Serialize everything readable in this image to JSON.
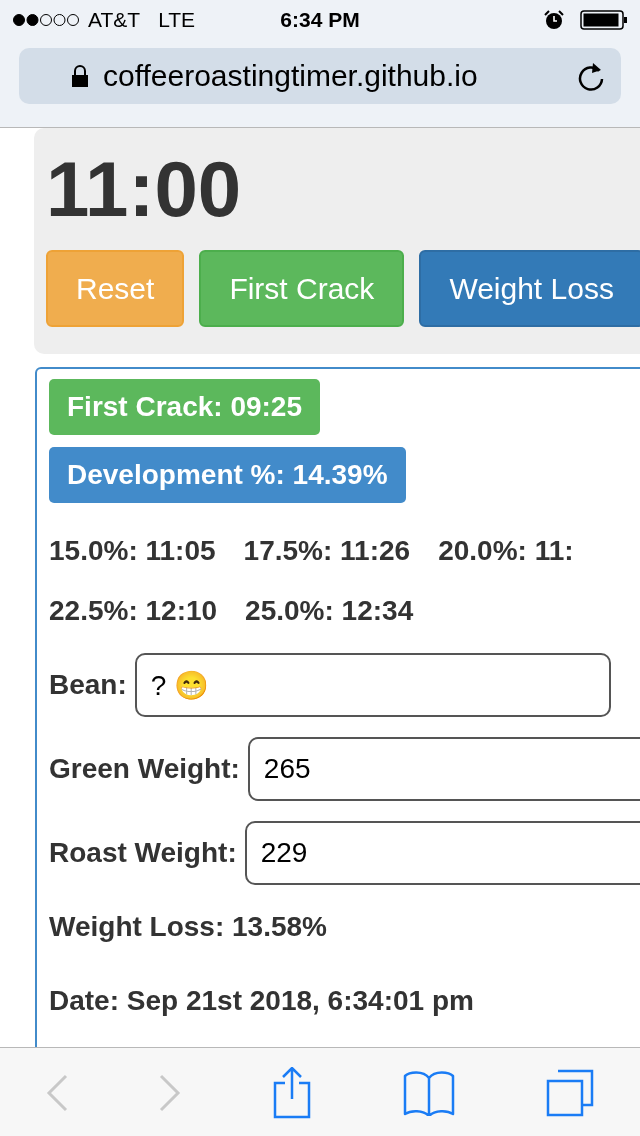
{
  "status_bar": {
    "carrier": "AT&T",
    "network": "LTE",
    "time": "6:34 PM"
  },
  "address_bar": {
    "url": "coffeeroastingtimer.github.io"
  },
  "timer": {
    "display": "11:00",
    "buttons": [
      {
        "label": "Reset",
        "kind": "warning"
      },
      {
        "label": "First Crack",
        "kind": "success"
      },
      {
        "label": "Weight Loss",
        "kind": "primary"
      }
    ]
  },
  "results": {
    "badges": [
      {
        "text": "First Crack: 09:25",
        "kind": "success"
      },
      {
        "text": "Development %: 14.39%",
        "kind": "info"
      }
    ],
    "target_rows": [
      [
        "15.0%: 11:05",
        "17.5%: 11:26",
        "20.0%: 11:"
      ],
      [
        "22.5%: 12:10",
        "25.0%: 12:34"
      ]
    ],
    "fields": [
      {
        "label": "Bean:",
        "value": "? 😁"
      },
      {
        "label": "Green Weight:",
        "value": "265"
      },
      {
        "label": "Roast Weight:",
        "value": "229"
      }
    ],
    "weight_loss": "Weight Loss: 13.58%",
    "date": "Date: Sep 21st 2018, 6:34:01 pm"
  }
}
